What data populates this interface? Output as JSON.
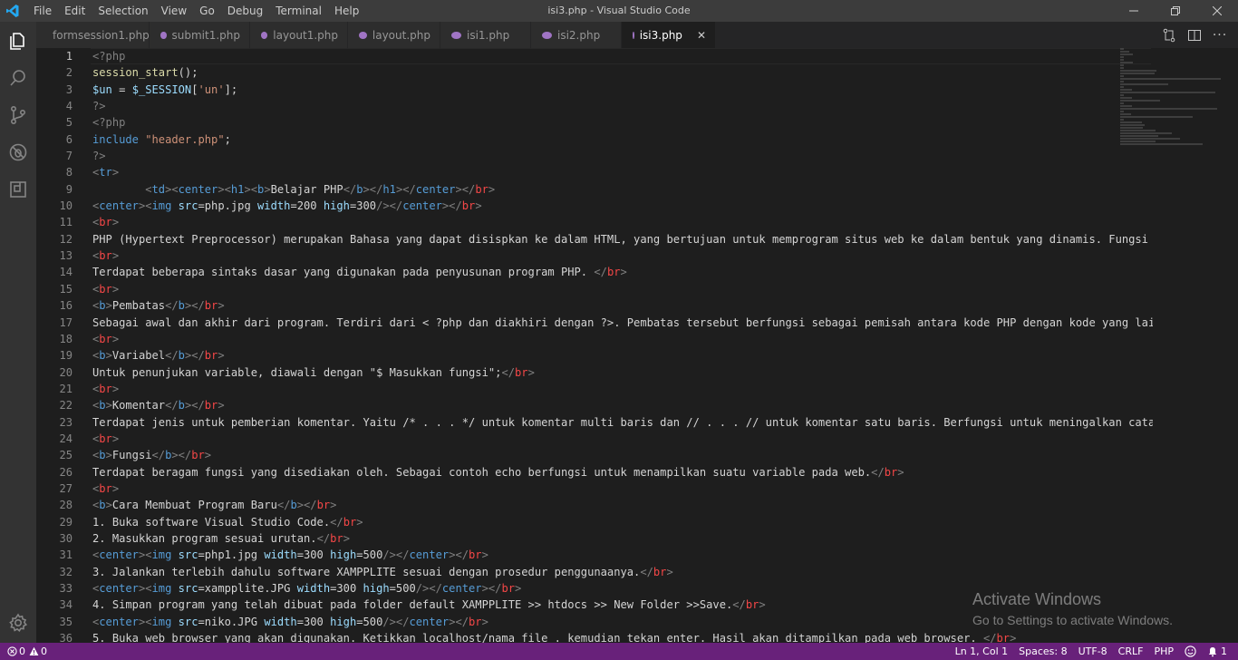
{
  "window": {
    "title": "isi3.php - Visual Studio Code"
  },
  "menu": [
    "File",
    "Edit",
    "Selection",
    "View",
    "Go",
    "Debug",
    "Terminal",
    "Help"
  ],
  "tabs": [
    {
      "label": "formsession1.php",
      "active": false
    },
    {
      "label": "submit1.php",
      "active": false
    },
    {
      "label": "layout1.php",
      "active": false
    },
    {
      "label": "layout.php",
      "active": false
    },
    {
      "label": "isi1.php",
      "active": false
    },
    {
      "label": "isi2.php",
      "active": false
    },
    {
      "label": "isi3.php",
      "active": true
    }
  ],
  "activity": [
    "explorer-icon",
    "search-icon",
    "source-control-icon",
    "debug-icon",
    "extensions-icon",
    "settings-gear-icon"
  ],
  "editor": {
    "current_line": 1,
    "lines": [
      "1",
      "2",
      "3",
      "4",
      "5",
      "6",
      "7",
      "8",
      "9",
      "10",
      "11",
      "12",
      "13",
      "14",
      "15",
      "16",
      "17",
      "18",
      "19",
      "20",
      "21",
      "22",
      "23",
      "24",
      "25",
      "26",
      "27",
      "28",
      "29",
      "30",
      "31",
      "32",
      "33",
      "34",
      "35",
      "36"
    ]
  },
  "code": [
    [
      [
        "t-tag",
        "<?php"
      ]
    ],
    [
      [
        "t-fn",
        "session_start"
      ],
      [
        "t-text",
        "();"
      ]
    ],
    [
      [
        "t-var",
        "$un"
      ],
      [
        "t-text",
        " = "
      ],
      [
        "t-var",
        "$_SESSION"
      ],
      [
        "t-text",
        "["
      ],
      [
        "t-str",
        "'un'"
      ],
      [
        "t-text",
        "];"
      ]
    ],
    [
      [
        "t-tag",
        "?>"
      ]
    ],
    [
      [
        "t-tag",
        "<?php"
      ]
    ],
    [
      [
        "t-kw",
        "include"
      ],
      [
        "t-text",
        " "
      ],
      [
        "t-str",
        "\"header.php\""
      ],
      [
        "t-text",
        ";"
      ]
    ],
    [
      [
        "t-tag",
        "?>"
      ]
    ],
    [
      [
        "t-tag",
        "<"
      ],
      [
        "t-name",
        "tr"
      ],
      [
        "t-tag",
        ">"
      ]
    ],
    [
      [
        "t-text",
        "        "
      ],
      [
        "t-tag",
        "<"
      ],
      [
        "t-name",
        "td"
      ],
      [
        "t-tag",
        "><"
      ],
      [
        "t-name",
        "center"
      ],
      [
        "t-tag",
        "><"
      ],
      [
        "t-name",
        "h1"
      ],
      [
        "t-tag",
        "><"
      ],
      [
        "t-name",
        "b"
      ],
      [
        "t-tag",
        ">"
      ],
      [
        "t-text",
        "Belajar PHP"
      ],
      [
        "t-tag",
        "</"
      ],
      [
        "t-name",
        "b"
      ],
      [
        "t-tag",
        "></"
      ],
      [
        "t-name",
        "h1"
      ],
      [
        "t-tag",
        "></"
      ],
      [
        "t-name",
        "center"
      ],
      [
        "t-tag",
        "></"
      ],
      [
        "t-ctag",
        "br"
      ],
      [
        "t-tag",
        ">"
      ]
    ],
    [
      [
        "t-tag",
        "<"
      ],
      [
        "t-name",
        "center"
      ],
      [
        "t-tag",
        "><"
      ],
      [
        "t-name",
        "img"
      ],
      [
        "t-text",
        " "
      ],
      [
        "t-attr",
        "src"
      ],
      [
        "t-text",
        "="
      ],
      [
        "t-text",
        "php.jpg "
      ],
      [
        "t-attr",
        "width"
      ],
      [
        "t-text",
        "=200 "
      ],
      [
        "t-attr",
        "high"
      ],
      [
        "t-text",
        "=300"
      ],
      [
        "t-tag",
        "/></"
      ],
      [
        "t-name",
        "center"
      ],
      [
        "t-tag",
        "></"
      ],
      [
        "t-ctag",
        "br"
      ],
      [
        "t-tag",
        ">"
      ]
    ],
    [
      [
        "t-tag",
        "<"
      ],
      [
        "t-ctag",
        "br"
      ],
      [
        "t-tag",
        ">"
      ]
    ],
    [
      [
        "t-text",
        "PHP (Hypertext Preprocessor) merupakan Bahasa yang dapat disispkan ke dalam HTML, yang bertujuan untuk memprogram situs web ke dalam bentuk yang dinamis. Fungsi PHP adalah"
      ]
    ],
    [
      [
        "t-tag",
        "<"
      ],
      [
        "t-ctag",
        "br"
      ],
      [
        "t-tag",
        ">"
      ]
    ],
    [
      [
        "t-text",
        "Terdapat beberapa sintaks dasar yang digunakan pada penyusunan program PHP. "
      ],
      [
        "t-tag",
        "</"
      ],
      [
        "t-ctag",
        "br"
      ],
      [
        "t-tag",
        ">"
      ]
    ],
    [
      [
        "t-tag",
        "<"
      ],
      [
        "t-ctag",
        "br"
      ],
      [
        "t-tag",
        ">"
      ]
    ],
    [
      [
        "t-tag",
        "<"
      ],
      [
        "t-name",
        "b"
      ],
      [
        "t-tag",
        ">"
      ],
      [
        "t-text",
        "Pembatas"
      ],
      [
        "t-tag",
        "</"
      ],
      [
        "t-name",
        "b"
      ],
      [
        "t-tag",
        "></"
      ],
      [
        "t-ctag",
        "br"
      ],
      [
        "t-tag",
        ">"
      ]
    ],
    [
      [
        "t-text",
        "Sebagai awal dan akhir dari program. Terdiri dari < ?php dan diakhiri dengan ?>. Pembatas tersebut berfungsi sebagai pemisah antara kode PHP dengan kode yang lain"
      ]
    ],
    [
      [
        "t-tag",
        "<"
      ],
      [
        "t-ctag",
        "br"
      ],
      [
        "t-tag",
        ">"
      ]
    ],
    [
      [
        "t-tag",
        "<"
      ],
      [
        "t-name",
        "b"
      ],
      [
        "t-tag",
        ">"
      ],
      [
        "t-text",
        "Variabel"
      ],
      [
        "t-tag",
        "</"
      ],
      [
        "t-name",
        "b"
      ],
      [
        "t-tag",
        "></"
      ],
      [
        "t-ctag",
        "br"
      ],
      [
        "t-tag",
        ">"
      ]
    ],
    [
      [
        "t-text",
        "Untuk penunjukan variable, diawali dengan \"$ Masukkan fungsi\";"
      ],
      [
        "t-tag",
        "</"
      ],
      [
        "t-ctag",
        "br"
      ],
      [
        "t-tag",
        ">"
      ]
    ],
    [
      [
        "t-tag",
        "<"
      ],
      [
        "t-ctag",
        "br"
      ],
      [
        "t-tag",
        ">"
      ]
    ],
    [
      [
        "t-tag",
        "<"
      ],
      [
        "t-name",
        "b"
      ],
      [
        "t-tag",
        ">"
      ],
      [
        "t-text",
        "Komentar"
      ],
      [
        "t-tag",
        "</"
      ],
      [
        "t-name",
        "b"
      ],
      [
        "t-tag",
        "></"
      ],
      [
        "t-ctag",
        "br"
      ],
      [
        "t-tag",
        ">"
      ]
    ],
    [
      [
        "t-text",
        "Terdapat jenis untuk pemberian komentar. Yaitu /* . . . */ untuk komentar multi baris dan // . . . // untuk komentar satu baris. Berfungsi untuk meningalkan catatan"
      ]
    ],
    [
      [
        "t-tag",
        "<"
      ],
      [
        "t-ctag",
        "br"
      ],
      [
        "t-tag",
        ">"
      ]
    ],
    [
      [
        "t-tag",
        "<"
      ],
      [
        "t-name",
        "b"
      ],
      [
        "t-tag",
        ">"
      ],
      [
        "t-text",
        "Fungsi"
      ],
      [
        "t-tag",
        "</"
      ],
      [
        "t-name",
        "b"
      ],
      [
        "t-tag",
        "></"
      ],
      [
        "t-ctag",
        "br"
      ],
      [
        "t-tag",
        ">"
      ]
    ],
    [
      [
        "t-text",
        "Terdapat beragam fungsi yang disediakan oleh. Sebagai contoh echo berfungsi untuk menampilkan suatu variable pada web."
      ],
      [
        "t-tag",
        "</"
      ],
      [
        "t-ctag",
        "br"
      ],
      [
        "t-tag",
        ">"
      ]
    ],
    [
      [
        "t-tag",
        "<"
      ],
      [
        "t-ctag",
        "br"
      ],
      [
        "t-tag",
        ">"
      ]
    ],
    [
      [
        "t-tag",
        "<"
      ],
      [
        "t-name",
        "b"
      ],
      [
        "t-tag",
        ">"
      ],
      [
        "t-text",
        "Cara Membuat Program Baru"
      ],
      [
        "t-tag",
        "</"
      ],
      [
        "t-name",
        "b"
      ],
      [
        "t-tag",
        "></"
      ],
      [
        "t-ctag",
        "br"
      ],
      [
        "t-tag",
        ">"
      ]
    ],
    [
      [
        "t-text",
        "1. Buka software Visual Studio Code."
      ],
      [
        "t-tag",
        "</"
      ],
      [
        "t-ctag",
        "br"
      ],
      [
        "t-tag",
        ">"
      ]
    ],
    [
      [
        "t-text",
        "2. Masukkan program sesuai urutan."
      ],
      [
        "t-tag",
        "</"
      ],
      [
        "t-ctag",
        "br"
      ],
      [
        "t-tag",
        ">"
      ]
    ],
    [
      [
        "t-tag",
        "<"
      ],
      [
        "t-name",
        "center"
      ],
      [
        "t-tag",
        "><"
      ],
      [
        "t-name",
        "img"
      ],
      [
        "t-text",
        " "
      ],
      [
        "t-attr",
        "src"
      ],
      [
        "t-text",
        "=php1.jpg "
      ],
      [
        "t-attr",
        "width"
      ],
      [
        "t-text",
        "=300 "
      ],
      [
        "t-attr",
        "high"
      ],
      [
        "t-text",
        "=500"
      ],
      [
        "t-tag",
        "/></"
      ],
      [
        "t-name",
        "center"
      ],
      [
        "t-tag",
        "></"
      ],
      [
        "t-ctag",
        "br"
      ],
      [
        "t-tag",
        ">"
      ]
    ],
    [
      [
        "t-text",
        "3. Jalankan terlebih dahulu software XAMPPLITE sesuai dengan prosedur penggunaanya."
      ],
      [
        "t-tag",
        "</"
      ],
      [
        "t-ctag",
        "br"
      ],
      [
        "t-tag",
        ">"
      ]
    ],
    [
      [
        "t-tag",
        "<"
      ],
      [
        "t-name",
        "center"
      ],
      [
        "t-tag",
        "><"
      ],
      [
        "t-name",
        "img"
      ],
      [
        "t-text",
        " "
      ],
      [
        "t-attr",
        "src"
      ],
      [
        "t-text",
        "=xampplite.JPG "
      ],
      [
        "t-attr",
        "width"
      ],
      [
        "t-text",
        "=300 "
      ],
      [
        "t-attr",
        "high"
      ],
      [
        "t-text",
        "=500"
      ],
      [
        "t-tag",
        "/></"
      ],
      [
        "t-name",
        "center"
      ],
      [
        "t-tag",
        "></"
      ],
      [
        "t-ctag",
        "br"
      ],
      [
        "t-tag",
        ">"
      ]
    ],
    [
      [
        "t-text",
        "4. Simpan program yang telah dibuat pada folder default XAMPPLITE >> htdocs >> New Folder >>Save."
      ],
      [
        "t-tag",
        "</"
      ],
      [
        "t-ctag",
        "br"
      ],
      [
        "t-tag",
        ">"
      ]
    ],
    [
      [
        "t-tag",
        "<"
      ],
      [
        "t-name",
        "center"
      ],
      [
        "t-tag",
        "><"
      ],
      [
        "t-name",
        "img"
      ],
      [
        "t-text",
        " "
      ],
      [
        "t-attr",
        "src"
      ],
      [
        "t-text",
        "=niko.JPG "
      ],
      [
        "t-attr",
        "width"
      ],
      [
        "t-text",
        "=300 "
      ],
      [
        "t-attr",
        "high"
      ],
      [
        "t-text",
        "=500"
      ],
      [
        "t-tag",
        "/></"
      ],
      [
        "t-name",
        "center"
      ],
      [
        "t-tag",
        "></"
      ],
      [
        "t-ctag",
        "br"
      ],
      [
        "t-tag",
        ">"
      ]
    ],
    [
      [
        "t-text",
        "5. Buka web browser yang akan digunakan. Ketikkan localhost/nama file . kemudian tekan enter. Hasil akan ditampilkan pada web browser. "
      ],
      [
        "t-tag",
        "</"
      ],
      [
        "t-ctag",
        "br"
      ],
      [
        "t-tag",
        ">"
      ]
    ]
  ],
  "watermark": {
    "title": "Activate Windows",
    "subtitle": "Go to Settings to activate Windows."
  },
  "status": {
    "errors": "0",
    "warnings": "0",
    "position": "Ln 1, Col 1",
    "spaces": "Spaces: 8",
    "encoding": "UTF-8",
    "eol": "CRLF",
    "language": "PHP",
    "notifications": "1"
  },
  "colors": {
    "statusbar": "#68217a",
    "titlebar": "#3c3c3c",
    "activitybar": "#333333",
    "editor": "#1e1e1e"
  }
}
